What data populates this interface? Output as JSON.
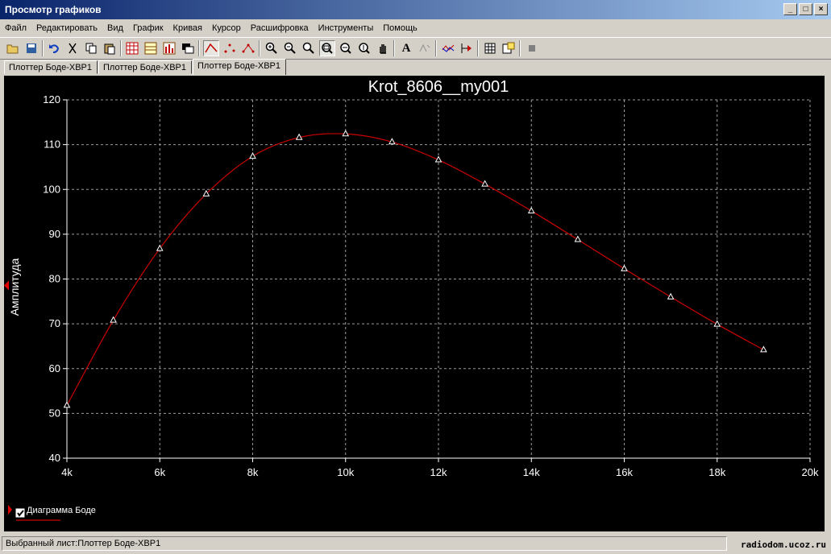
{
  "window": {
    "title": "Просмотр графиков",
    "controls": [
      "_",
      "□",
      "×"
    ]
  },
  "menu": [
    "Файл",
    "Редактировать",
    "Вид",
    "График",
    "Кривая",
    "Курсор",
    "Расшифровка",
    "Инструменты",
    "Помощь"
  ],
  "toolbar": {
    "icons": [
      "open-icon",
      "save-icon",
      "undo-icon",
      "cut-icon",
      "copy-icon",
      "paste-icon",
      "grid-icon",
      "bode-icon",
      "bars-icon",
      "overlay-icon",
      "curve-icon",
      "points-icon",
      "markers-icon",
      "zoom-in-icon",
      "zoom-out-icon",
      "zoom-fit-icon",
      "zoom-area-icon",
      "zoom-x-icon",
      "zoom-y-icon",
      "pan-icon",
      "text-icon",
      "label-icon",
      "cursor-icon",
      "export-icon",
      "copy-graph-icon",
      "properties-icon",
      "stop-icon"
    ]
  },
  "tabs": [
    "Плоттер Боде-XBP1",
    "Плоттер Боде-XBP1",
    "Плоттер Боде-XBP1"
  ],
  "active_tab": 2,
  "legend": {
    "label": "Диаграмма Боде"
  },
  "status": {
    "text": "Выбранный лист:Плоттер Боде-XBP1"
  },
  "watermark": "radiodom.ucoz.ru",
  "chart_data": {
    "type": "line",
    "title": "Krot_8606__my001",
    "ylabel": "Амплитуда",
    "xlabel": "",
    "xlim": [
      4000,
      20000
    ],
    "ylim": [
      40,
      120
    ],
    "xticks": [
      4000,
      6000,
      8000,
      10000,
      12000,
      14000,
      16000,
      18000,
      20000
    ],
    "xtick_labels": [
      "4k",
      "6k",
      "8k",
      "10k",
      "12k",
      "14k",
      "16k",
      "18k",
      "20k"
    ],
    "yticks": [
      40,
      50,
      60,
      70,
      80,
      90,
      100,
      110,
      120
    ],
    "ytick_labels": [
      "40",
      "50",
      "60",
      "70",
      "80",
      "90",
      "100",
      "110",
      "120"
    ],
    "grid": true,
    "line_color": "#cc0000",
    "marker_color": "#ffffff",
    "series": [
      {
        "name": "Диаграмма Боде",
        "x": [
          4000,
          5000,
          6000,
          7000,
          8000,
          9000,
          10000,
          11000,
          12000,
          13000,
          14000,
          15000,
          16000,
          17000,
          18000,
          19000
        ],
        "y": [
          51.8,
          70.8,
          86.8,
          99.0,
          107.4,
          111.6,
          112.4,
          110.6,
          106.6,
          101.2,
          95.2,
          88.8,
          82.3,
          76.0,
          69.9,
          64.2
        ]
      }
    ]
  }
}
